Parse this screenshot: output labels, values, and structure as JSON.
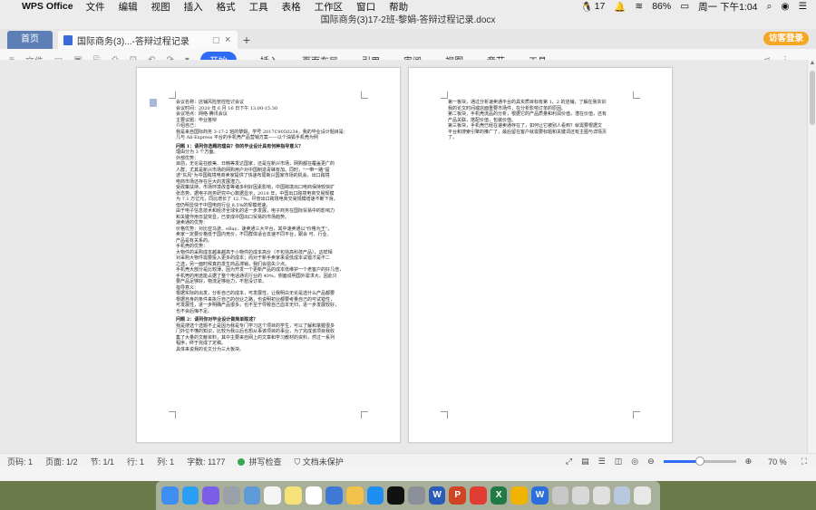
{
  "menubar": {
    "app": "WPS Office",
    "items": [
      "文件",
      "编辑",
      "视图",
      "插入",
      "格式",
      "工具",
      "表格",
      "工作区",
      "窗口",
      "帮助"
    ],
    "right": {
      "qq_badge": "17",
      "battery": "86%",
      "clock": "周一 下午1:04"
    }
  },
  "window": {
    "title": "国际商务(3)17-2班-黎娟-答辩过程记录.docx",
    "home_tab": "首页",
    "doc_tab": "国际商务(3)...-答辩过程记录",
    "guest_login": "访客登录"
  },
  "ribbon": {
    "file": "文件",
    "tabs": [
      "开始",
      "插入",
      "页面布局",
      "引用",
      "审阅",
      "视图",
      "章节",
      "工具"
    ],
    "active": "开始"
  },
  "page1": {
    "lines": [
      "会议名称：店铺风险管控检讨会议",
      "会议时间：2020 年 6 月 16 日下午 13.00-15.30",
      "会议地点：网络-腾讯会议",
      "主要议题：毕业答辩",
      "介绍自己：",
      "我是来自国际商务 3-17-2 班的黎娟，学号 2017C9050234，我的毕业设计题目是：",
      "几与 Ali-Express 平台的手机壳产品营销方案——以个油狐手机壳为例"
    ],
    "q1": "问题 1：请列你选题的理由？你的毕业设计具有何种指导意义？",
    "q1_body": [
      "理由分为 3 个方面。",
      "外部优势：",
      "目前，无论是在欧美、日韩等发达国家，还是在新兴市场，网购都在覆盖更广的",
      "人群，尤其是新兴市场的网购用户对中国制造青睐有加。同时，\"一带一路\"提",
      "述\"东风\"为中国跨境电商卖家提供了快速布局新兴国家市场的机会，出口跨境",
      "电商市场还存在巨大的发展潜力。",
      "受政策扶持，市场环境改善等诸多利好因素影响，中国跨境出口电商保持较快扩",
      "张态势。据电子商务研究中心数据显示，2018 年，中国出口跨境电商交易规模",
      "为 7.1 万亿元，同比增长了 12.7%。尽管出口跨境电商交易规模增速不断下滑，",
      "但仍明显快于中国电商行业 8.5%的规模增速。",
      "由于电子信息技术和经济全球化的进一步发展，电子商务在国际贸易中的影响力",
      "和关键作用日益突显，已变成中国出口贸易的市场趋势。",
      "速卖通的优势：",
      "价格优势：对比亚马逊、eBay、速卖通三大平台，其中速卖通以\"价格为王\"，",
      "卖家一定要价格低于国内竞价，不同群体适合去速不同平台，跟会 可、行业、",
      "产品是有关系的。",
      "手机壳的优势：",
      "大物件的采购成本越来越高于小物件的成本高价（不包括高科技产品），这样相",
      "对采购大物件需要投入更多的成本；而对于新手卖家来说低成本试错才是不二",
      "之选，另一面时候真的发生商品滞销，我们会损失少点。",
      "手机壳大部分是比较薄，因为开发一个更新产品的成本低维护一个老客户的好几倍，",
      "手机壳的用途能占据了整个电话通讯行业的 40%，侧面说明国外需求大。因此只",
      "要产品足够好，物流足够给力，不愁没订单。",
      "指导意义：",
      "根据实际的出发，分析自己的成本，可发展性，让我明白无论是选什么产品都要",
      "根据自身的条件来执行自己的创业之路，也说明初业都要考量自己的可试错性，",
      "可发展性，进一步明确产品很多，也不至于导致自己血本无归，进一步发展较好，",
      "也不会后悔不足。"
    ],
    "q2": "问题 2：请列你对毕业设计做简单陈述？",
    "q2_body": [
      "我是搜选个选题不止是因为我是专门学习这个项目的学生，可以了解和掌握很多",
      "门外位不懂的知识，比较为我以后也想从事该项目的事业，为了完成该项目我收",
      "集了大量的文献资料，其中主要来自网上的文章和学习教材的资料，然过一系列",
      "程序，终于完成了定稿。",
      "具体来说我的论文分为三大板块。"
    ]
  },
  "page2": {
    "lines": [
      "第一板块，通过分析速卖通平台的具实质目标有第 1、2 的店铺，了解在我实训",
      "我的论文时间或店面重要市场件，在分析影响订单的原因。",
      "第二板块，手机壳流品的分析，根据它的产品质量和利润价值，潜在价值，还有",
      "产品关联，搭配价值，包装价值。",
      "第三板块，手机壳已经在速卖通存在了，如何让它被别人看到？就需要根据文",
      "平台和搜索引擎的推广了，最后留在客户就需要标题和关键词还有主图与详情页",
      "了。"
    ]
  },
  "statusbar": {
    "page": "页码: 1",
    "pages": "页面: 1/2",
    "section": "节: 1/1",
    "row": "行: 1",
    "col": "列: 1",
    "words": "字数: 1177",
    "spell": "拼写检查",
    "protect": "文档未保护",
    "zoom": "70 %",
    "zoom_level": 0.5
  }
}
